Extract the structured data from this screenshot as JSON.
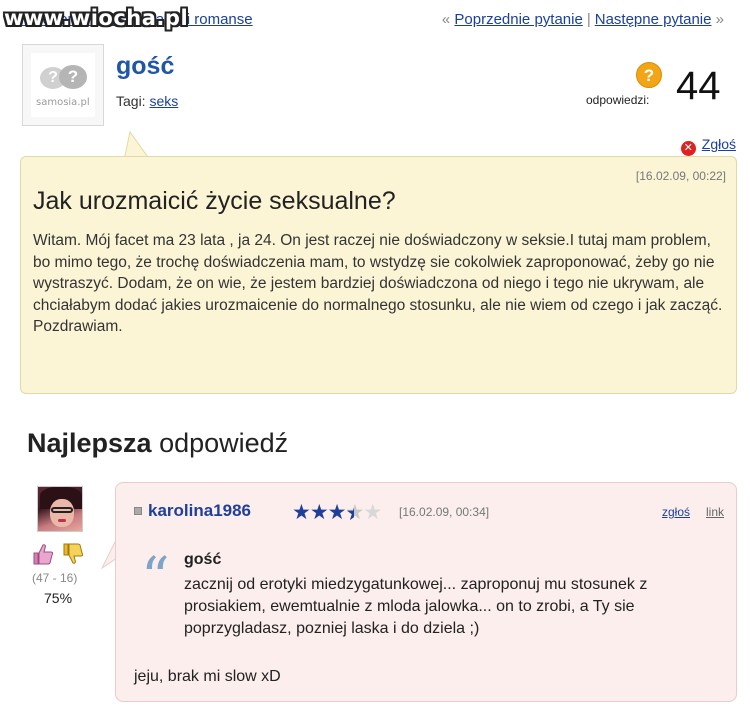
{
  "watermark": "www.wiocha.pl",
  "breadcrumb": {
    "text": "Kategoria: Seks, związki i romanse"
  },
  "nav": {
    "prev_arrow": "«",
    "prev_label": "Poprzednie pytanie",
    "separator": "|",
    "next_label": "Następne pytanie",
    "next_arrow": "»"
  },
  "asker": {
    "logo_text": "samosia.pl",
    "name": "gość",
    "tags_label": "Tagi:",
    "tag": "seks"
  },
  "answers": {
    "label": "odpowiedzi:",
    "count": "44"
  },
  "report_label": "Zgłoś",
  "question": {
    "date": "[16.02.09, 00:22]",
    "title": "Jak urozmaicić życie seksualne?",
    "body": "Witam. Mój facet ma 23 lata , ja 24. On jest raczej nie doświadczony w seksie.I tutaj mam problem, bo mimo tego, że trochę doświadczenia mam, to wstydzę sie cokolwiek zaproponować, żeby go nie wystraszyć. Dodam, że on wie, że jestem bardziej doświadczona od niego i tego nie ukrywam, ale chciałabym dodać jakies urozmaicenie do normalnego stosunku, ale nie wiem od czego i jak zacząć. Pozdrawiam."
  },
  "best_answer": {
    "heading_bold": "Najlepsza",
    "heading_rest": "odpowiedź",
    "votes": "(47 - 16)",
    "percent": "75%",
    "rating": 3.5,
    "user": "karolina1986",
    "date": "[16.02.09, 00:34]",
    "report_label": "zgłoś",
    "link_label": "link",
    "quote_author": "gość",
    "quote_text": "zacznij od erotyki miedzygatunkowej... zaproponuj mu stosunek z prosiakiem, ewemtualnie z mloda jalowka... on to zrobi, a Ty sie poprzygladasz, pozniej laska i do dziela ;)",
    "body": "jeju, brak mi slow xD"
  },
  "colors": {
    "link": "#1a3fa0",
    "question_bg": "#fbf5d6",
    "answer_bg": "#fbeeed",
    "star": "#1f3f9a",
    "answers_badge": "#f2a516"
  }
}
